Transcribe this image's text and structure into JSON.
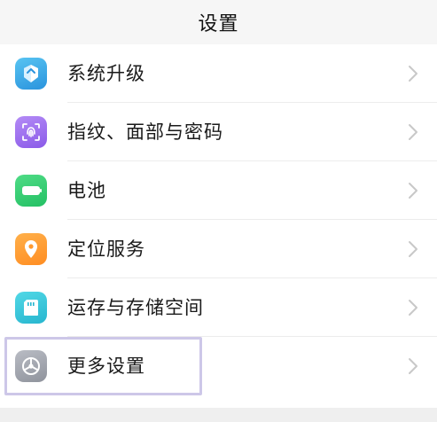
{
  "header": {
    "title": "设置"
  },
  "settings": {
    "items": [
      {
        "label": "系统升级",
        "icon": "system-upgrade-icon"
      },
      {
        "label": "指纹、面部与密码",
        "icon": "fingerprint-icon"
      },
      {
        "label": "电池",
        "icon": "battery-icon"
      },
      {
        "label": "定位服务",
        "icon": "location-icon"
      },
      {
        "label": "运存与存储空间",
        "icon": "storage-icon"
      },
      {
        "label": "更多设置",
        "icon": "more-settings-icon"
      }
    ]
  },
  "colors": {
    "highlight_border": "#cdc7e8",
    "chevron": "#c8c8c8",
    "upgrade_icon": "#3aa8e8",
    "fingerprint_icon": "#9d6ef0",
    "battery_icon": "#2fcc70",
    "location_icon": "#ff9a30",
    "storage_icon": "#33c4d8",
    "more_icon": "#a3a6ae"
  }
}
